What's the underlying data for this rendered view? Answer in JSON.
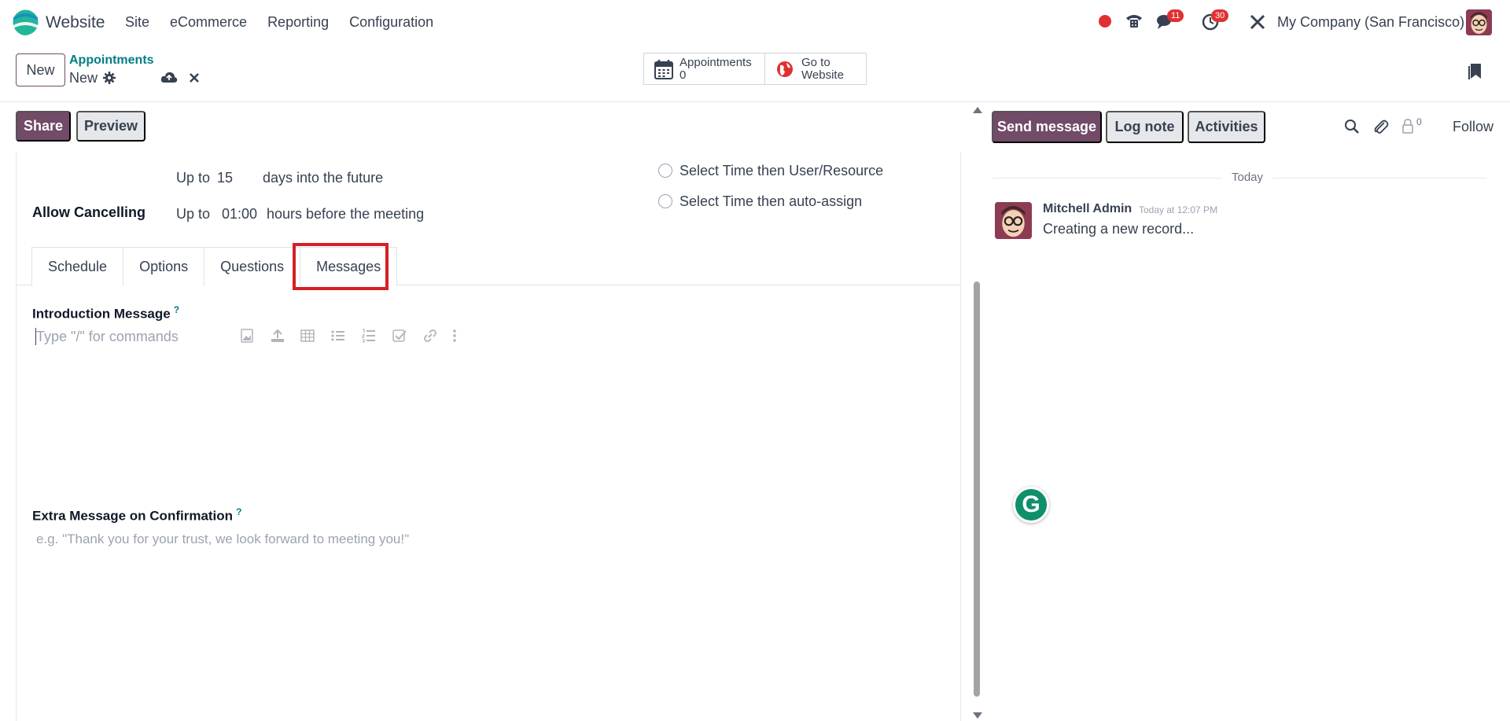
{
  "navbar": {
    "app_name": "Website",
    "menu": [
      "Site",
      "eCommerce",
      "Reporting",
      "Configuration"
    ],
    "chat_badge": "11",
    "activity_badge": "30",
    "company": "My Company (San Francisco)"
  },
  "control_panel": {
    "new_label": "New",
    "breadcrumb_parent": "Appointments",
    "breadcrumb_current": "New",
    "smart_appointments_label": "Appointments",
    "smart_appointments_count": "0",
    "smart_website_line1": "Go to",
    "smart_website_line2": "Website"
  },
  "form_actions": {
    "share": "Share",
    "preview": "Preview"
  },
  "form": {
    "scheduling_upto": "Up to",
    "scheduling_days": "15",
    "scheduling_suffix": "days into the future",
    "cancel_label": "Allow Cancelling",
    "cancel_upto": "Up to",
    "cancel_hours": "01:00",
    "cancel_suffix": "hours before the meeting",
    "radio_1": "Select Time then User/Resource",
    "radio_2": "Select Time then auto-assign"
  },
  "tabs": [
    "Schedule",
    "Options",
    "Questions",
    "Messages"
  ],
  "messages_tab": {
    "intro_label": "Introduction Message",
    "intro_placeholder": "Type \"/\" for commands",
    "confirm_label": "Extra Message on Confirmation",
    "confirm_placeholder": "e.g. \"Thank you for your trust, we look forward to meeting you!\"",
    "help_mark": "?"
  },
  "chatter": {
    "send_message": "Send message",
    "log_note": "Log note",
    "activities": "Activities",
    "follower_count": "0",
    "follow": "Follow",
    "date_separator": "Today",
    "message": {
      "author": "Mitchell Admin",
      "date": "Today at 12:07 PM",
      "body": "Creating a new record..."
    }
  },
  "colors": {
    "primary": "#714b67",
    "link": "#017e84",
    "badge": "#e03131",
    "highlight": "#d61f26"
  }
}
